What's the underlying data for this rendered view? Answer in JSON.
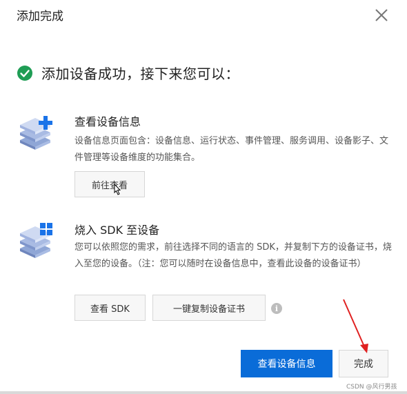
{
  "dialog": {
    "title": "添加完成",
    "close_icon": "close-icon"
  },
  "success": {
    "icon": "check-circle-icon",
    "message": "添加设备成功，接下来您可以："
  },
  "sections": [
    {
      "icon": "stack-plus-icon",
      "title": "查看设备信息",
      "description": "设备信息页面包含：设备信息、运行状态、事件管理、服务调用、设备影子、文件管理等设备维度的功能集合。",
      "buttons": [
        "前往查看"
      ]
    },
    {
      "icon": "stack-grid-icon",
      "title": "烧入 SDK 至设备",
      "description": "您可以依照您的需求，前往选择不同的语言的 SDK，并复制下方的设备证书，烧入至您的设备。（注：您可以随时在设备信息中，查看此设备的设备证书）",
      "buttons": [
        "查看 SDK",
        "一键复制设备证书"
      ],
      "info_icon": "info-icon",
      "info_glyph": "i"
    }
  ],
  "footer": {
    "primary_button": "查看设备信息",
    "done_button": "完成"
  },
  "watermark": "CSDN @风行男孩",
  "colors": {
    "primary": "#0a6cd8",
    "success": "#1f9d55",
    "icon_blue": "#1a73e8",
    "annotation": "#e02020"
  }
}
